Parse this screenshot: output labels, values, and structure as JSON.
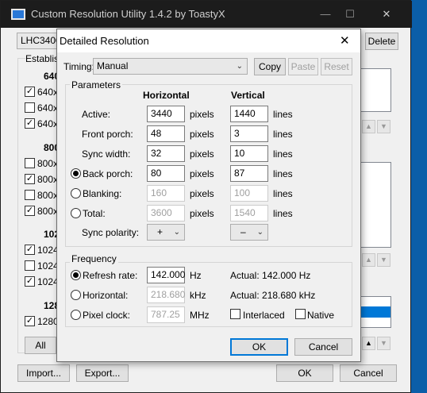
{
  "main": {
    "title": "Custom Resolution Utility 1.4.2 by ToastyX",
    "minimize": "—",
    "maximize": "☐",
    "close": "✕",
    "monitor": "LHC3400",
    "delete_label": "Delete",
    "established_label": "Establis",
    "res_groups": [
      {
        "header": "640",
        "items": [
          {
            "label": "640x",
            "checked": true
          },
          {
            "label": "640x",
            "checked": false
          },
          {
            "label": "640x",
            "checked": true
          }
        ]
      },
      {
        "header": "800",
        "items": [
          {
            "label": "800x",
            "checked": false
          },
          {
            "label": "800x",
            "checked": true
          },
          {
            "label": "800x",
            "checked": false
          },
          {
            "label": "800x",
            "checked": true
          }
        ]
      },
      {
        "header": "102",
        "items": [
          {
            "label": "1024",
            "checked": true
          },
          {
            "label": "1024",
            "checked": false
          },
          {
            "label": "1024",
            "checked": true
          }
        ]
      },
      {
        "header": "128",
        "items": [
          {
            "label": "1280",
            "checked": true
          }
        ]
      }
    ],
    "all_label": "All",
    "import_label": "Import...",
    "export_label": "Export...",
    "ok_label": "OK",
    "cancel_label": "Cancel",
    "up_arrow": "▲",
    "down_arrow": "▼"
  },
  "dialog": {
    "title": "Detailed Resolution",
    "close": "✕",
    "timing_label": "Timing:",
    "timing_value": "Manual",
    "copy_label": "Copy",
    "paste_label": "Paste",
    "reset_label": "Reset",
    "parameters_label": "Parameters",
    "horizontal_header": "Horizontal",
    "vertical_header": "Vertical",
    "rows": [
      {
        "label": "Active:",
        "h": "3440",
        "h_unit": "pixels",
        "v": "1440",
        "v_unit": "lines",
        "radio": null,
        "enabled": true
      },
      {
        "label": "Front porch:",
        "h": "48",
        "h_unit": "pixels",
        "v": "3",
        "v_unit": "lines",
        "radio": null,
        "enabled": true
      },
      {
        "label": "Sync width:",
        "h": "32",
        "h_unit": "pixels",
        "v": "10",
        "v_unit": "lines",
        "radio": null,
        "enabled": true
      },
      {
        "label": "Back porch:",
        "h": "80",
        "h_unit": "pixels",
        "v": "87",
        "v_unit": "lines",
        "radio": true,
        "enabled": true
      },
      {
        "label": "Blanking:",
        "h": "160",
        "h_unit": "pixels",
        "v": "100",
        "v_unit": "lines",
        "radio": false,
        "enabled": false
      },
      {
        "label": "Total:",
        "h": "3600",
        "h_unit": "pixels",
        "v": "1540",
        "v_unit": "lines",
        "radio": false,
        "enabled": false
      }
    ],
    "sync_polarity_label": "Sync polarity:",
    "h_polarity": "+",
    "v_polarity": "–",
    "frequency_label": "Frequency",
    "refresh_label": "Refresh rate:",
    "refresh_value": "142.000",
    "refresh_unit": "Hz",
    "refresh_actual": "Actual: 142.000 Hz",
    "horizontal_label": "Horizontal:",
    "horizontal_value": "218.680",
    "horizontal_unit": "kHz",
    "horizontal_actual": "Actual: 218.680 kHz",
    "pixelclock_label": "Pixel clock:",
    "pixelclock_value": "787.25",
    "pixelclock_unit": "MHz",
    "interlaced_label": "Interlaced",
    "native_label": "Native",
    "ok_label": "OK",
    "cancel_label": "Cancel"
  }
}
